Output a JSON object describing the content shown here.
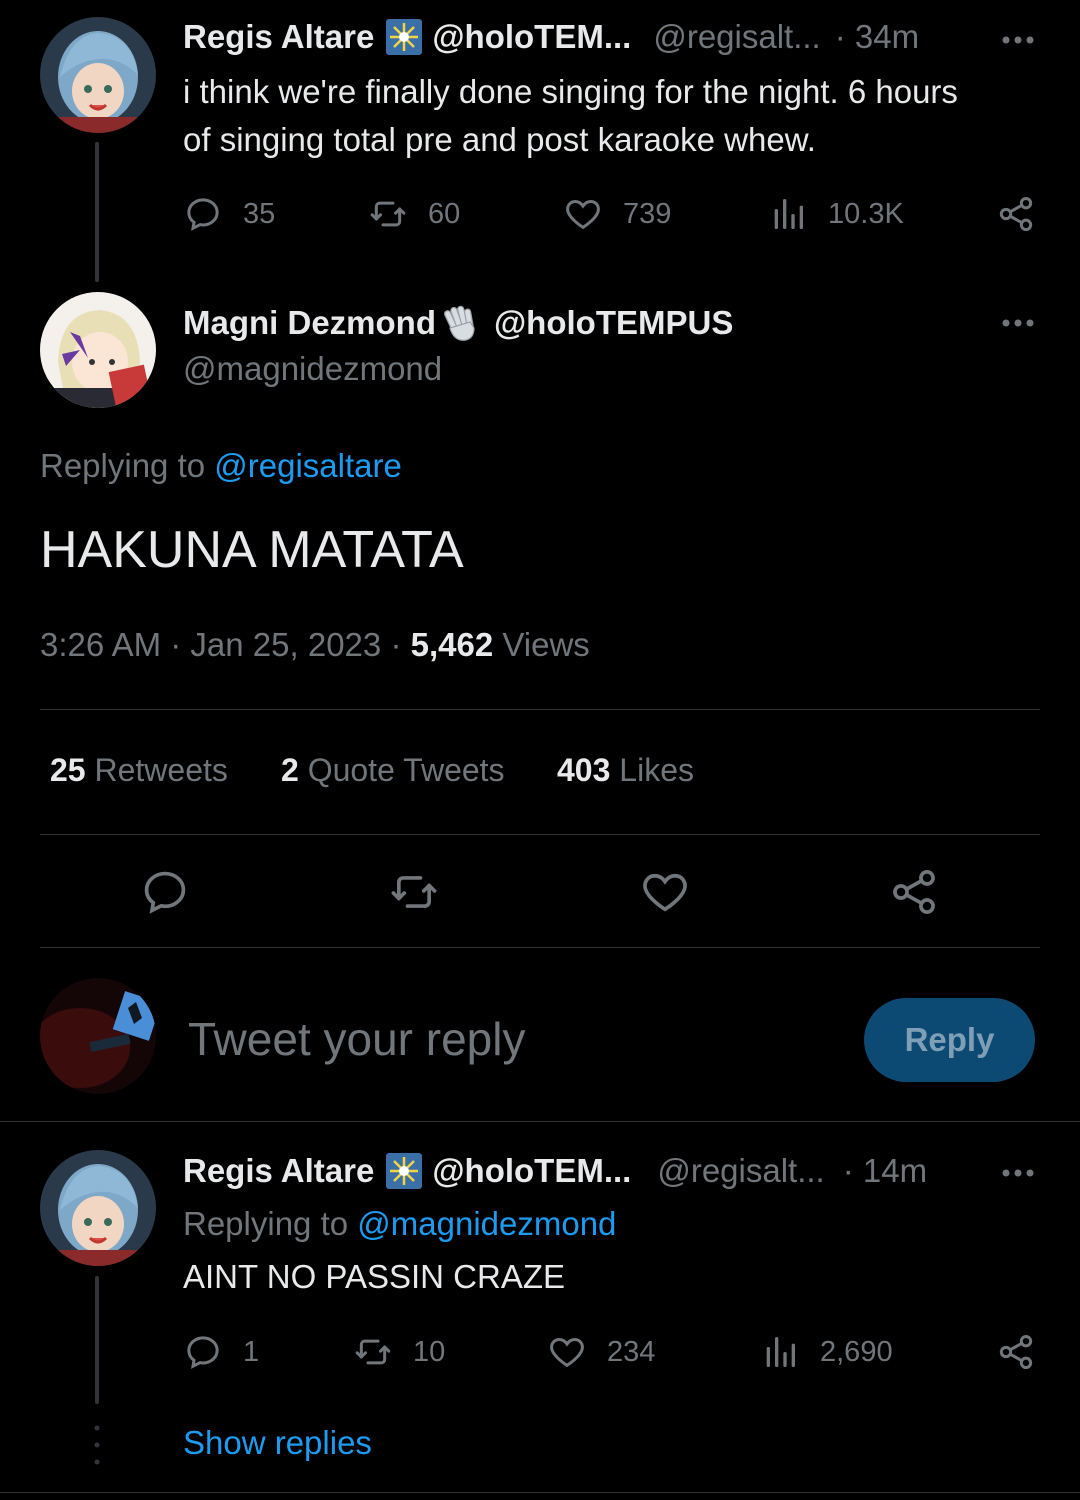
{
  "parent_tweet": {
    "name": "Regis Altare",
    "affiliation": "@holoTEM...",
    "handle": "@regisalt...",
    "time": "· 34m",
    "text_line1": "i think we're finally done singing for the night. 6 hours",
    "text_line2": "of singing total pre and post karaoke whew.",
    "replies": "35",
    "retweets": "60",
    "likes": "739",
    "views": "10.3K"
  },
  "main_tweet": {
    "name": "Magni Dezmond",
    "affiliation": "@holoTEMPUS",
    "handle": "@magnidezmond",
    "replying_prefix": "Replying to",
    "replying_handle": "@regisaltare",
    "text": "HAKUNA MATATA",
    "time": "3:26 AM",
    "date": "Jan 25, 2023",
    "views_count": "5,462",
    "views_label": "Views",
    "retweets_count": "25",
    "retweets_label": "Retweets",
    "quotes_count": "2",
    "quotes_label": "Quote Tweets",
    "likes_count": "403",
    "likes_label": "Likes"
  },
  "composer": {
    "placeholder": "Tweet your reply",
    "reply_label": "Reply"
  },
  "reply_tweet": {
    "name": "Regis Altare",
    "affiliation": "@holoTEM...",
    "handle": "@regisalt...",
    "time": "· 14m",
    "replying_prefix": "Replying to",
    "replying_handle": "@magnidezmond",
    "text": "AINT NO PASSIN CRAZE",
    "replies": "1",
    "retweets": "10",
    "likes": "234",
    "views": "2,690",
    "show_replies": "Show replies"
  },
  "colors": {
    "background": "#000000",
    "text": "#e7e9ea",
    "secondary": "#71767b",
    "link": "#1d9bf0",
    "reply_button": "#0d4a73"
  }
}
